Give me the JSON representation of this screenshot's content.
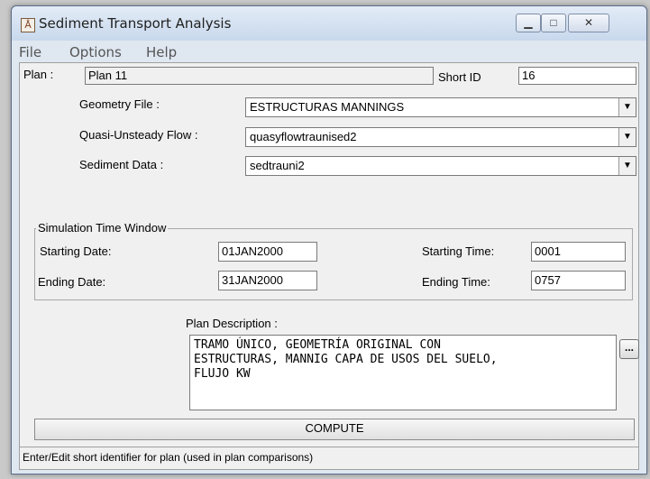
{
  "window": {
    "title": "Sediment Transport Analysis",
    "min_glyph": "▁",
    "max_glyph": "□",
    "close_glyph": "✕"
  },
  "menu": [
    "File",
    "Options",
    "Help"
  ],
  "plan": {
    "label": "Plan :",
    "value": "Plan 11",
    "short_id_label": "Short ID",
    "short_id": "16"
  },
  "geometry": {
    "label": "Geometry File :",
    "value": "ESTRUCTURAS MANNINGS"
  },
  "flow": {
    "label": "Quasi-Unsteady Flow :",
    "value": "quasyflowtraunised2"
  },
  "sediment": {
    "label": "Sediment Data :",
    "value": "sedtrauni2"
  },
  "simulation": {
    "title": "Simulation Time Window",
    "start_date_label": "Starting Date:",
    "start_date": "01JAN2000",
    "end_date_label": "Ending Date:",
    "end_date": "31JAN2000",
    "start_time_label": "Starting Time:",
    "start_time": "0001",
    "end_time_label": "Ending Time:",
    "end_time": "0757"
  },
  "description": {
    "label": "Plan Description :",
    "text": "TRAMO ÚNICO, GEOMETRÍA ORIGINAL CON\nESTRUCTURAS, MANNIG CAPA DE USOS DEL SUELO,\nFLUJO KW",
    "ellipsis": "..."
  },
  "compute_label": "COMPUTE",
  "status": "Enter/Edit short identifier for plan (used in plan comparisons)"
}
